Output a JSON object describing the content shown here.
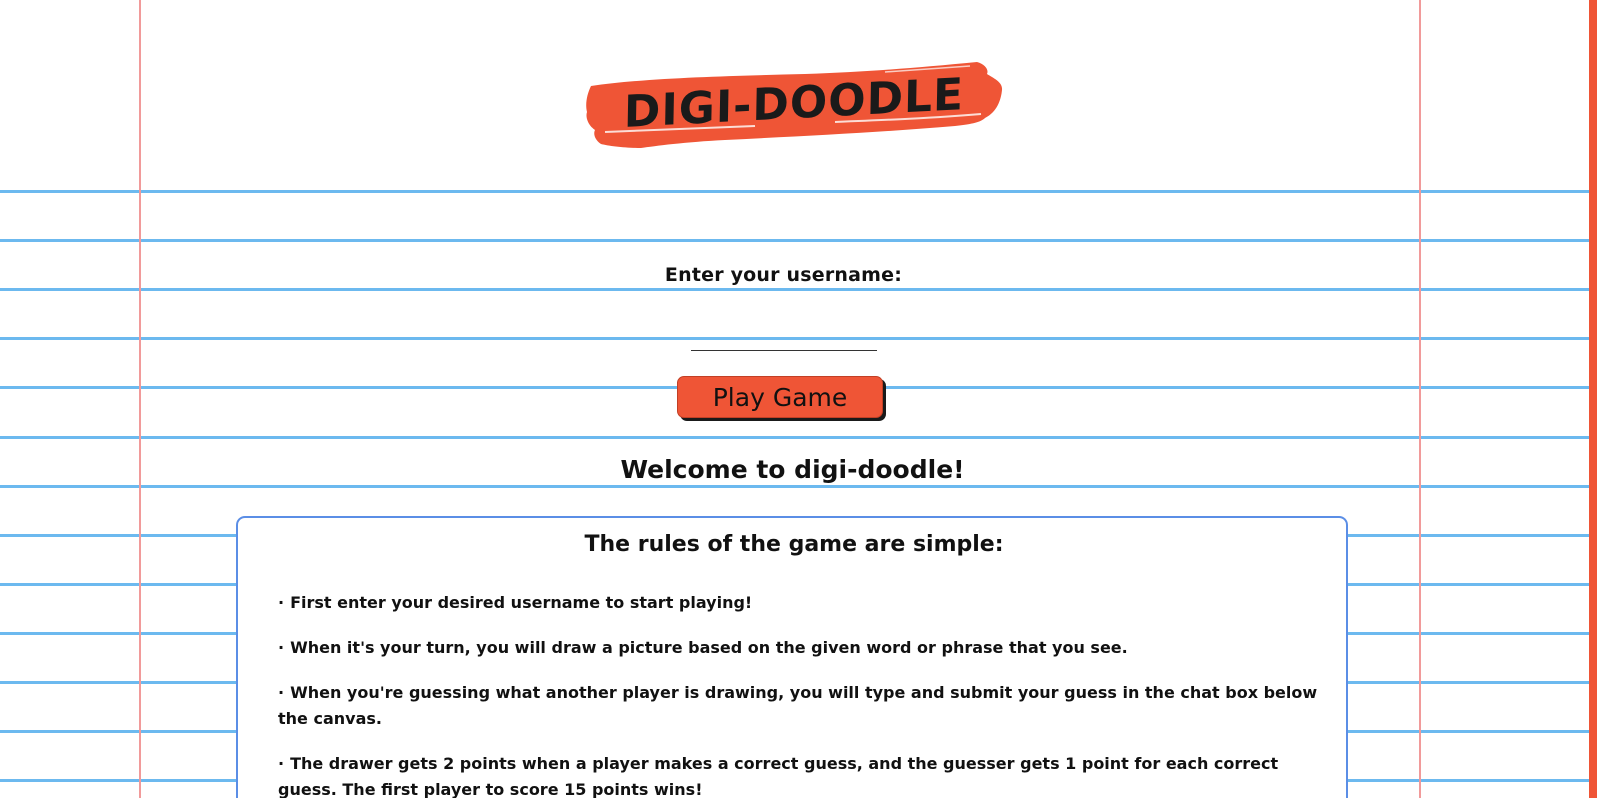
{
  "app": {
    "title": "DIGI-DOODLE"
  },
  "colors": {
    "accent": "#ef5536",
    "rule_line": "#6cb9ef",
    "margin_line": "#f19a9a",
    "box_border": "#5b8ee6"
  },
  "login": {
    "username_label": "Enter your username:",
    "username_value": "",
    "username_placeholder": "",
    "play_button_label": "Play Game"
  },
  "welcome": {
    "heading": "Welcome to digi-doodle!"
  },
  "rules": {
    "title": "The rules of the game are simple:",
    "items": [
      "First enter your desired username to start playing!",
      "When it's your turn, you will draw a picture based on the given word or phrase that you see.",
      "When you're guessing what another player is drawing, you will type and submit your guess in the chat box below the canvas.",
      "The drawer gets 2 points when a player makes a correct guess, and the guesser gets 1 point for each correct guess. The first player to score 15 points wins!"
    ]
  }
}
